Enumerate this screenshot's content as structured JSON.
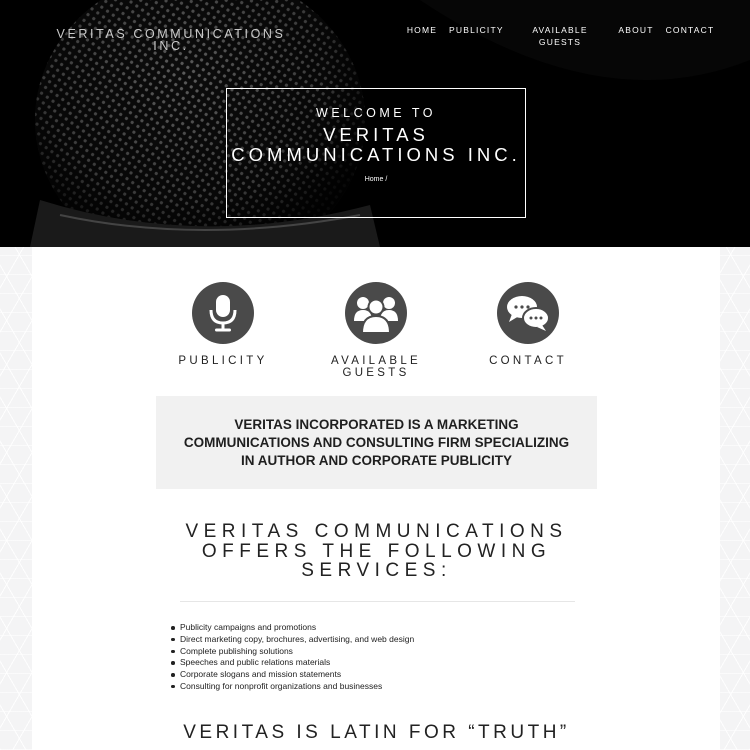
{
  "header": {
    "site_title": "VERITAS COMMUNICATIONS INC.",
    "nav": [
      {
        "label": "HOME"
      },
      {
        "label": "PUBLICITY"
      },
      {
        "label": "AVAILABLE GUESTS"
      },
      {
        "label": "ABOUT"
      },
      {
        "label": "CONTACT"
      }
    ]
  },
  "hero": {
    "welcome": "WELCOME TO",
    "title": "VERITAS COMMUNICATIONS INC.",
    "breadcrumb": "Home /"
  },
  "features": [
    {
      "label": "PUBLICITY",
      "icon": "microphone-icon"
    },
    {
      "label": "AVAILABLE GUESTS",
      "icon": "group-icon"
    },
    {
      "label": "CONTACT",
      "icon": "chat-bubbles-icon"
    }
  ],
  "intro": {
    "text": "VERITAS INCORPORATED IS A MARKETING COMMUNICATIONS AND CONSULTING FIRM SPECIALIZING IN AUTHOR AND CORPORATE PUBLICITY"
  },
  "services": {
    "heading": "VERITAS COMMUNICATIONS OFFERS THE FOLLOWING SERVICES:",
    "items": [
      "Publicity campaigns and promotions",
      "Direct marketing copy, brochures, advertising, and web design",
      "Complete publishing solutions",
      "Speeches and public relations materials",
      "Corporate slogans and mission statements",
      "Consulting for nonprofit organizations and businesses"
    ]
  },
  "latin": {
    "heading": "VERITAS IS LATIN FOR “TRUTH”"
  },
  "colors": {
    "hero_bg": "#000000",
    "icon_circle": "#4a4a4a",
    "intro_bg": "#f1f1f1",
    "text": "#222222"
  }
}
